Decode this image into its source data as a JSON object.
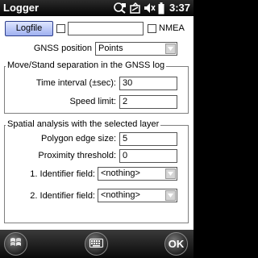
{
  "window": {
    "title": "Logger",
    "clock": "3:37"
  },
  "status_icons": [
    "gps-status-icon",
    "connectivity-icon",
    "volume-icon",
    "battery-icon"
  ],
  "top_row": {
    "logfile_button": "Logfile",
    "logfile_path": "",
    "nmea_label": "NMEA",
    "logfile_checked": false,
    "nmea_checked": false
  },
  "gnss": {
    "label": "GNSS position",
    "value": "Points"
  },
  "move_stand": {
    "title": "Move/Stand separation in the GNSS log",
    "time_interval_label": "Time interval (±sec):",
    "time_interval_value": "30",
    "speed_limit_label": "Speed limit:",
    "speed_limit_value": "2"
  },
  "spatial": {
    "title": "Spatial analysis with the selected layer",
    "polygon_edge_label": "Polygon edge size:",
    "polygon_edge_value": "5",
    "proximity_label": "Proximity threshold:",
    "proximity_value": "0",
    "identifier1_label": "1. Identifier field:",
    "identifier1_value": "<nothing>",
    "identifier2_label": "2. Identifier field:",
    "identifier2_value": "<nothing>"
  },
  "softkeys": {
    "ok_label": "OK"
  }
}
